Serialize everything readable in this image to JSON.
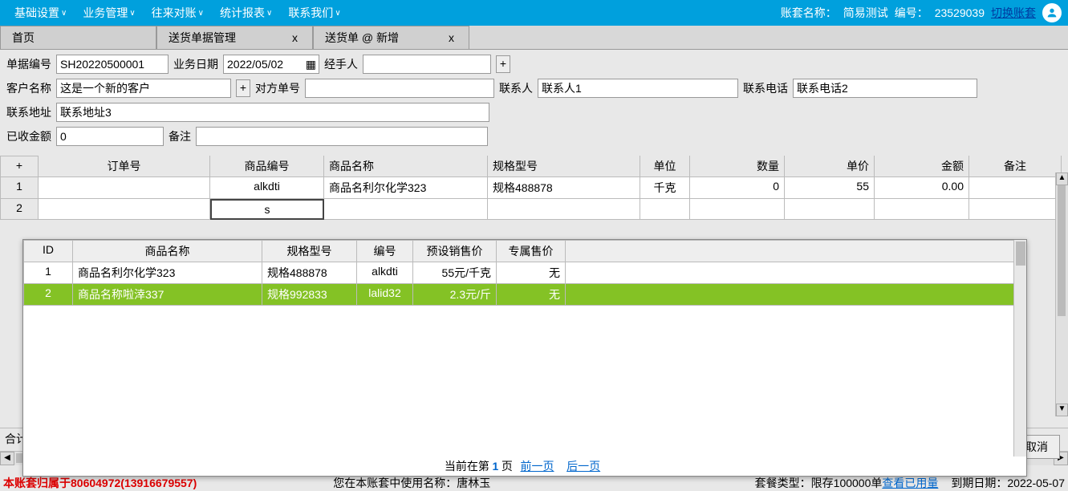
{
  "topbar": {
    "menus": [
      "基础设置",
      "业务管理",
      "往来对账",
      "统计报表",
      "联系我们"
    ],
    "acct_label": "账套名称：",
    "acct_name": "简易测试",
    "code_label": "编号：",
    "code": "23529039",
    "switch": "切换账套"
  },
  "tabs": [
    {
      "label": "首页",
      "closable": false
    },
    {
      "label": "送货单据管理",
      "closable": true
    },
    {
      "label": "送货单 @ 新增",
      "closable": true
    }
  ],
  "form": {
    "doc_no_lbl": "单据编号",
    "doc_no": "SH20220500001",
    "biz_date_lbl": "业务日期",
    "biz_date": "2022/05/02",
    "handler_lbl": "经手人",
    "handler": "",
    "cust_lbl": "客户名称",
    "cust": "这是一个新的客户",
    "their_no_lbl": "对方单号",
    "their_no": "",
    "contact_lbl": "联系人",
    "contact": "联系人1",
    "phone_lbl": "联系电话",
    "phone": "联系电话2",
    "addr_lbl": "联系地址",
    "addr": "联系地址3",
    "recv_lbl": "已收金额",
    "recv": "0",
    "remark_lbl": "备注",
    "remark": ""
  },
  "grid": {
    "headers": {
      "order": "订单号",
      "code": "商品编号",
      "name": "商品名称",
      "spec": "规格型号",
      "unit": "单位",
      "qty": "数量",
      "price": "单价",
      "amt": "金额",
      "note": "备注"
    },
    "rows": [
      {
        "n": "1",
        "order": "",
        "code": "alkdti",
        "name": "商品名利尔化学323",
        "spec": "规格488878",
        "unit": "千克",
        "qty": "0",
        "price": "55",
        "amt": "0.00",
        "note": ""
      },
      {
        "n": "2",
        "order": "",
        "code": "s",
        "name": "",
        "spec": "",
        "unit": "",
        "qty": "",
        "price": "",
        "amt": "",
        "note": ""
      }
    ],
    "total_lbl": "合计"
  },
  "popup": {
    "headers": {
      "id": "ID",
      "name": "商品名称",
      "spec": "规格型号",
      "code": "编号",
      "price": "预设销售价",
      "excl": "专属售价"
    },
    "rows": [
      {
        "id": "1",
        "name": "商品名利尔化学323",
        "spec": "规格488878",
        "code": "alkdti",
        "price": "55元/千克",
        "excl": "无",
        "sel": false
      },
      {
        "id": "2",
        "name": "商品名称啦涬337",
        "spec": "规格992833",
        "code": "lalid32",
        "price": "2.3元/斤",
        "excl": "无",
        "sel": true
      }
    ],
    "pager": {
      "cur_lbl": "当前在第",
      "cur": "1",
      "page_lbl": "页",
      "prev": "前一页",
      "next": "后一页"
    }
  },
  "cancel": "取消",
  "footer": {
    "owner": "本账套归属于80604972(13916679557)",
    "using_lbl": "您在本账套中使用名称：",
    "using": "唐林玉",
    "pkg_lbl": "套餐类型：",
    "pkg": "限存100000单",
    "usage": "查看已用量",
    "due_lbl": "到期日期：",
    "due": "2022-05-07"
  }
}
